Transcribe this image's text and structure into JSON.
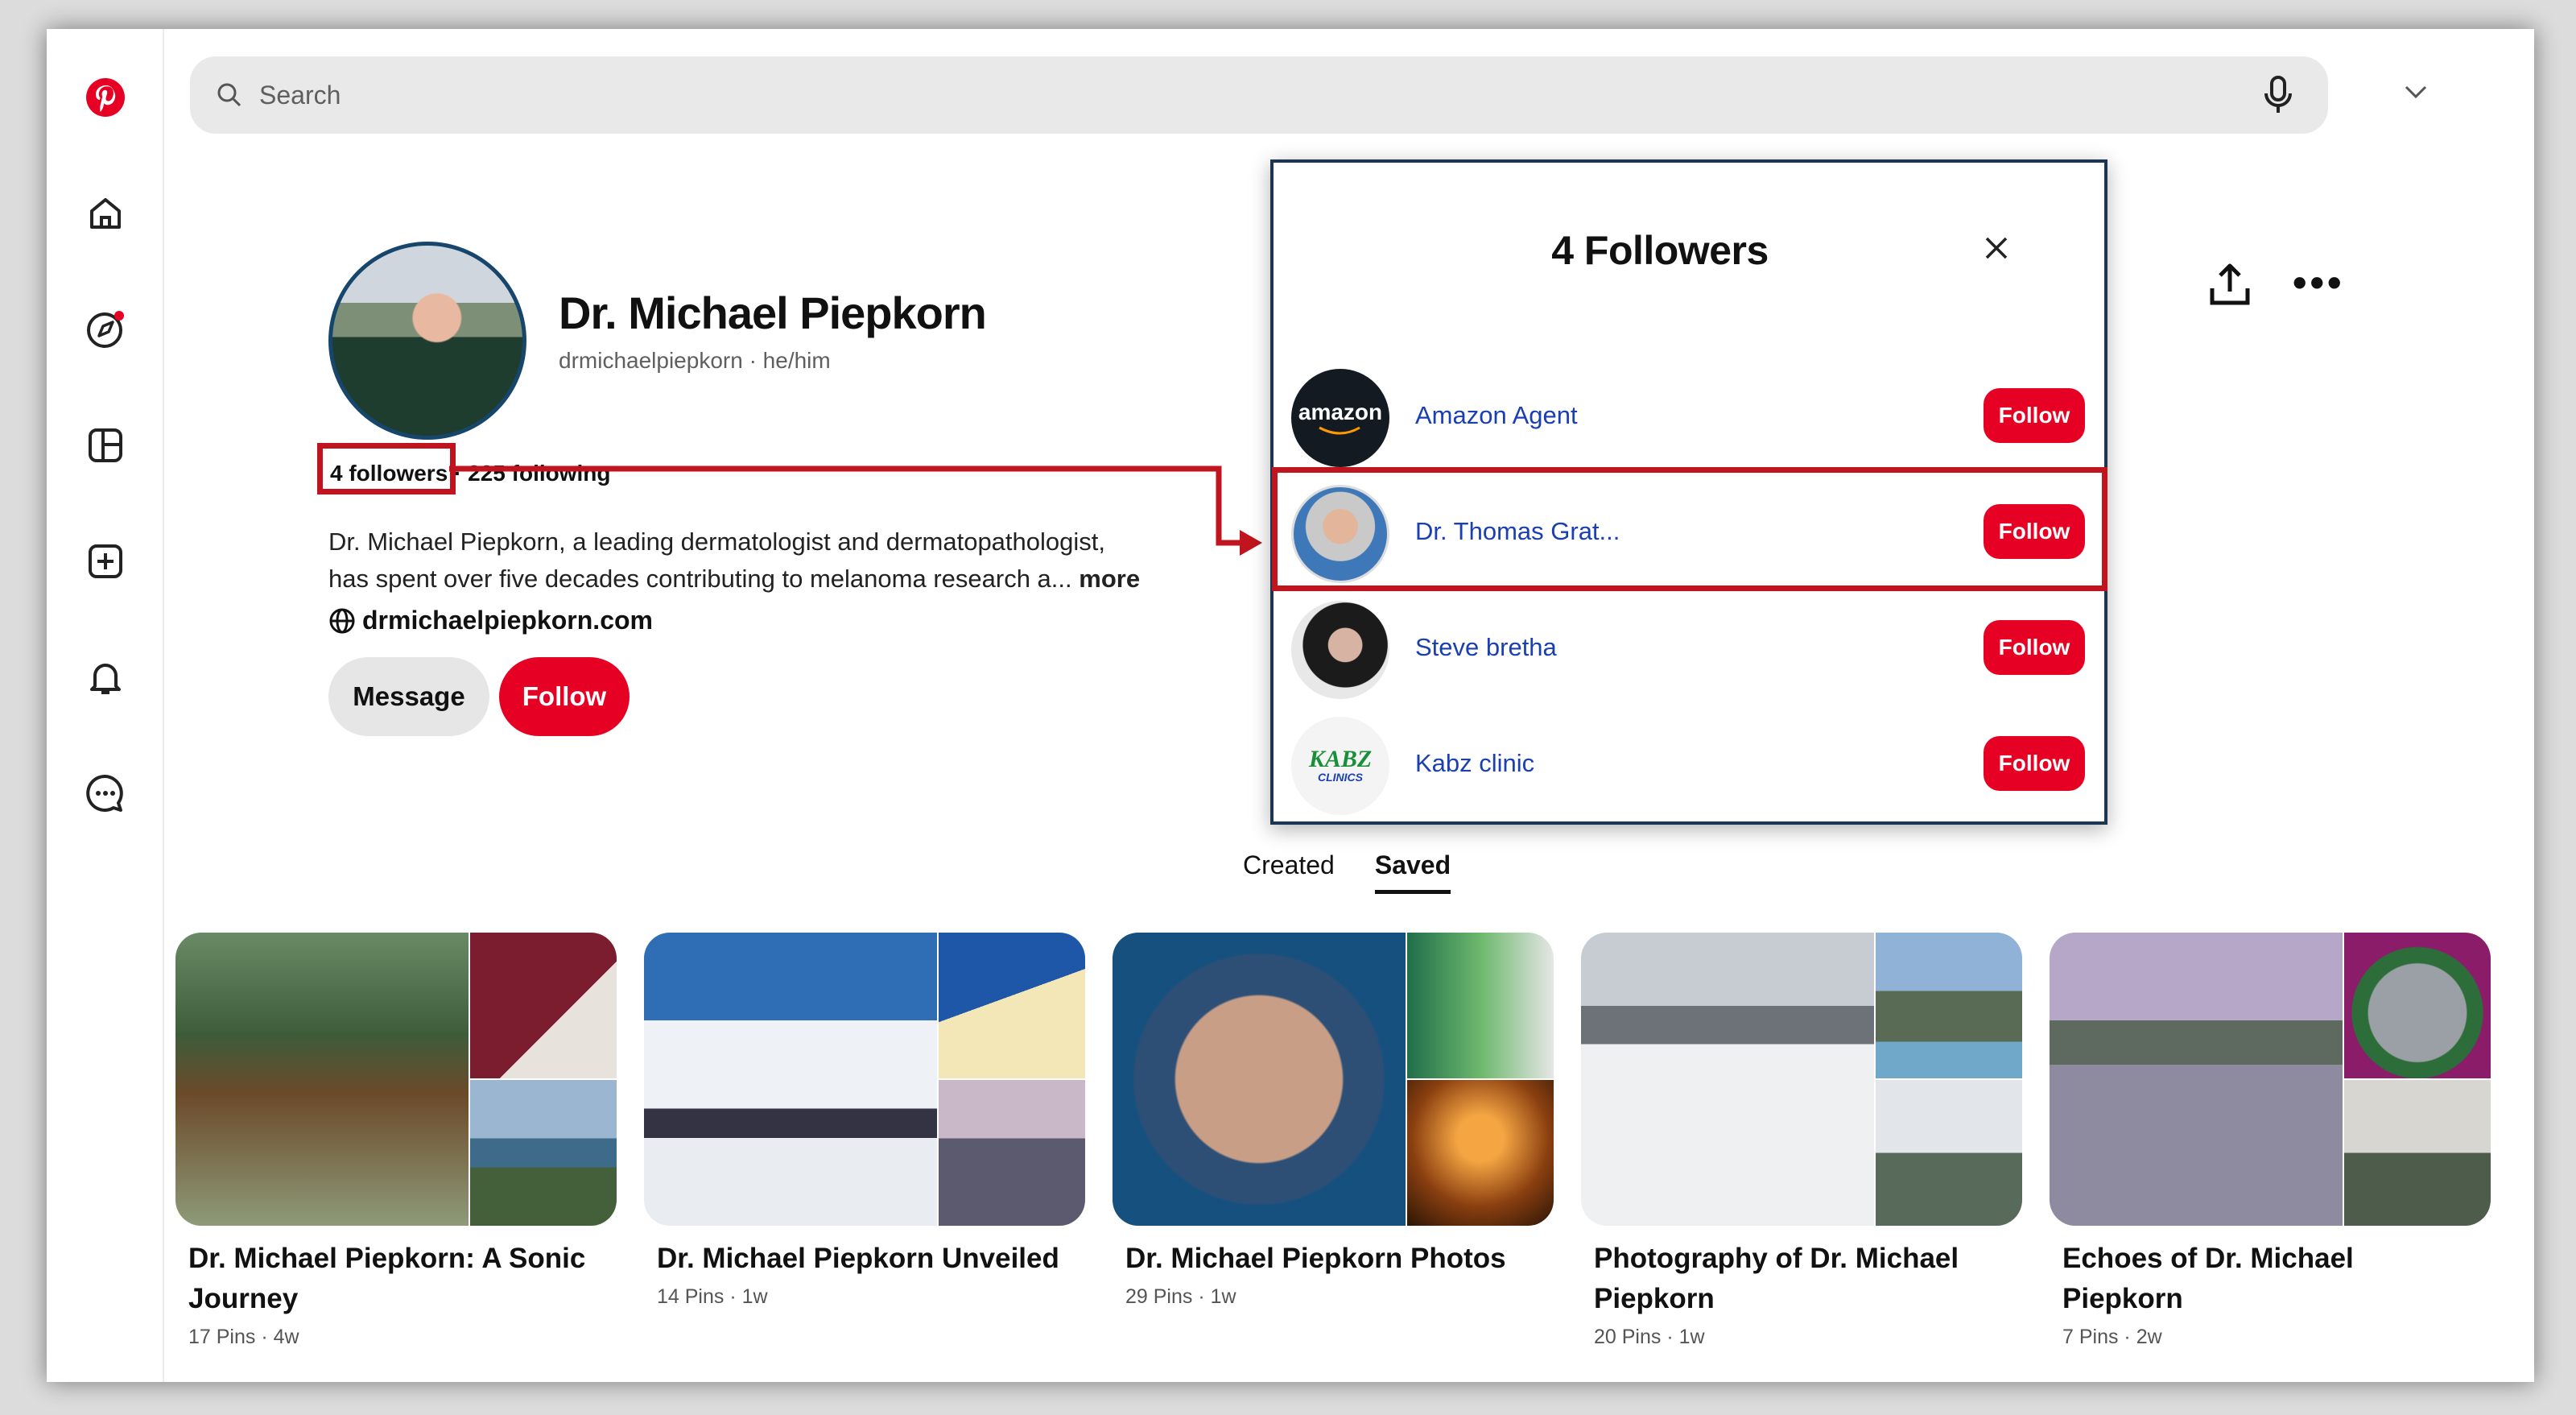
{
  "search": {
    "placeholder": "Search"
  },
  "rail": {
    "items": [
      "pinterest-logo",
      "home",
      "explore",
      "boards",
      "create",
      "notifications",
      "messages"
    ]
  },
  "profile": {
    "name": "Dr. Michael Piepkorn",
    "handle": "drmichaelpiepkorn · he/him",
    "followers": "4 followers",
    "following": "225 following",
    "bio_line1": "Dr. Michael Piepkorn, a leading dermatologist and dermatopathologist,",
    "bio_line2": "has spent over five decades contributing to melanoma research a...",
    "bio_more": "more",
    "website": "drmichaelpiepkorn.com",
    "message_label": "Message",
    "follow_label": "Follow"
  },
  "tabs": [
    {
      "label": "Created"
    },
    {
      "label": "Saved"
    }
  ],
  "boards": [
    {
      "title": "Dr. Michael Piepkorn: A Sonic Journey",
      "meta": "17 Pins · 4w"
    },
    {
      "title": "Dr. Michael Piepkorn Unveiled",
      "meta": "14 Pins · 1w"
    },
    {
      "title": "Dr. Michael Piepkorn Photos",
      "meta": "29 Pins · 1w"
    },
    {
      "title": "Photography of Dr. Michael Piepkorn",
      "meta": "20 Pins · 1w"
    },
    {
      "title": "Echoes of Dr. Michael Piepkorn",
      "meta": "7 Pins · 2w"
    }
  ],
  "modal": {
    "title": "4 Followers",
    "followers": [
      {
        "name": "Amazon Agent",
        "follow": "Follow",
        "avatar_text": "amazon"
      },
      {
        "name": "Dr. Thomas Grat...",
        "follow": "Follow"
      },
      {
        "name": "Steve bretha",
        "follow": "Follow"
      },
      {
        "name": "Kabz clinic",
        "follow": "Follow",
        "avatar_text": "KABZ",
        "avatar_sub": "CLINICS"
      }
    ]
  },
  "colors": {
    "brand": "#e60023",
    "highlight": "#c0141e",
    "link": "#1a3fb0"
  }
}
